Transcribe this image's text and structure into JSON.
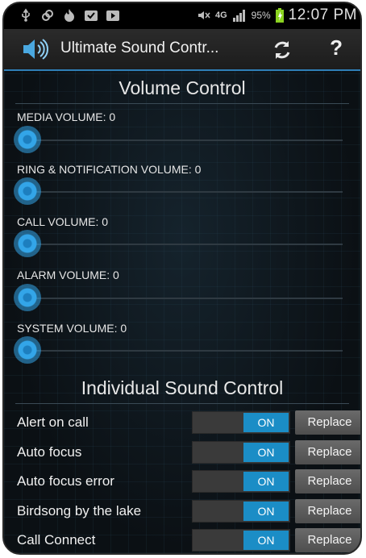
{
  "status_bar": {
    "battery": "95%",
    "time": "12:07 PM",
    "network": "4G"
  },
  "app": {
    "title": "Ultimate Sound Contr..."
  },
  "volume_section": {
    "header": "Volume Control",
    "sliders": [
      {
        "label": "MEDIA VOLUME: 0",
        "value": 0
      },
      {
        "label": "RING & NOTIFICATION VOLUME: 0",
        "value": 0
      },
      {
        "label": "CALL VOLUME: 0",
        "value": 0
      },
      {
        "label": "ALARM VOLUME: 0",
        "value": 0
      },
      {
        "label": "SYSTEM VOLUME: 0",
        "value": 0
      }
    ]
  },
  "individual_section": {
    "header": "Individual Sound Control",
    "rows": [
      {
        "name": "Alert on call",
        "toggle": "ON",
        "button": "Replace"
      },
      {
        "name": "Auto focus",
        "toggle": "ON",
        "button": "Replace"
      },
      {
        "name": "Auto focus error",
        "toggle": "ON",
        "button": "Replace"
      },
      {
        "name": "Birdsong by the lake",
        "toggle": "ON",
        "button": "Replace"
      },
      {
        "name": "Call Connect",
        "toggle": "ON",
        "button": "Replace"
      }
    ]
  },
  "colors": {
    "accent": "#33a5e8",
    "toggle_on": "#1b8dc6",
    "background": "#0b1014"
  }
}
